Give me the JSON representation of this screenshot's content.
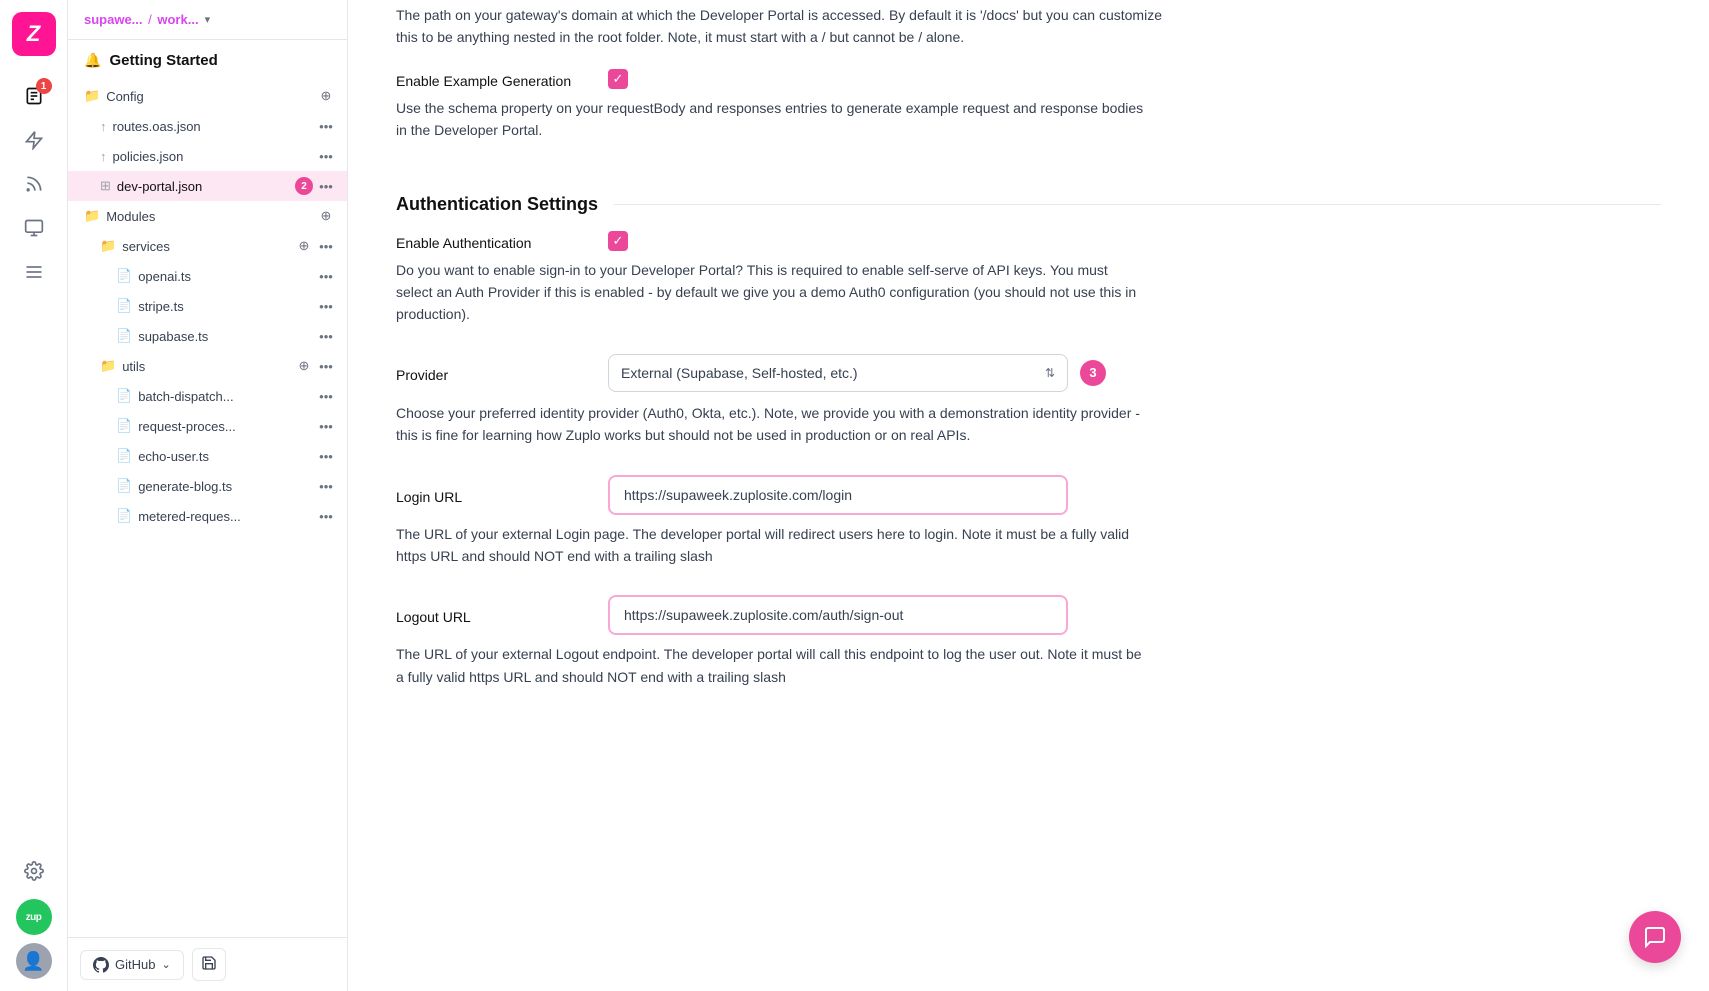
{
  "app": {
    "logo": "Z",
    "workspace": {
      "org": "supawe...",
      "sep": "/",
      "work": "work...",
      "chevron": "▾"
    }
  },
  "sidebar": {
    "getting_started": "Getting Started",
    "items": [
      {
        "id": "config",
        "label": "Config",
        "icon": "folder",
        "indent": 0,
        "has_plus": true
      },
      {
        "id": "routes-oas",
        "label": "routes.oas.json",
        "icon": "file-arrow",
        "indent": 1,
        "has_dots": true
      },
      {
        "id": "policies-json",
        "label": "policies.json",
        "icon": "file-arrow",
        "indent": 1,
        "has_dots": true
      },
      {
        "id": "dev-portal-json",
        "label": "dev-portal.json",
        "icon": "grid",
        "indent": 1,
        "has_dots": true,
        "active": true,
        "badge": "2"
      },
      {
        "id": "modules",
        "label": "Modules",
        "icon": "folder",
        "indent": 0,
        "has_plus": true
      },
      {
        "id": "services",
        "label": "services",
        "icon": "folder",
        "indent": 1,
        "has_plus": true,
        "has_dots": true
      },
      {
        "id": "openai-ts",
        "label": "openai.ts",
        "icon": "file",
        "indent": 2,
        "has_dots": true
      },
      {
        "id": "stripe-ts",
        "label": "stripe.ts",
        "icon": "file",
        "indent": 2,
        "has_dots": true
      },
      {
        "id": "supabase-ts",
        "label": "supabase.ts",
        "icon": "file",
        "indent": 2,
        "has_dots": true
      },
      {
        "id": "utils",
        "label": "utils",
        "icon": "folder",
        "indent": 1,
        "has_plus": true,
        "has_dots": true
      },
      {
        "id": "batch-dispatch",
        "label": "batch-dispatch...",
        "icon": "file",
        "indent": 2,
        "has_dots": true
      },
      {
        "id": "request-process",
        "label": "request-proces...",
        "icon": "file",
        "indent": 2,
        "has_dots": true
      },
      {
        "id": "echo-user-ts",
        "label": "echo-user.ts",
        "icon": "file",
        "indent": 2,
        "has_dots": true
      },
      {
        "id": "generate-blog",
        "label": "generate-blog.ts",
        "icon": "file",
        "indent": 2,
        "has_dots": true
      },
      {
        "id": "metered-reques",
        "label": "metered-reques...",
        "icon": "file",
        "indent": 2,
        "has_dots": true
      }
    ],
    "footer": {
      "github_label": "GitHub",
      "save_icon": "💾"
    }
  },
  "icons": {
    "docs": "📄",
    "lightning": "⚡",
    "feed": "📡",
    "monitor": "🖥",
    "list": "☰",
    "settings": "⚙",
    "zup": "zup",
    "chat": "💬"
  },
  "main": {
    "intro_text": "The path on your gateway's domain at which the Developer Portal is accessed. By default it is '/docs' but you can customize this to be anything nested in the root folder. Note, it must start with a / but cannot be / alone.",
    "enable_example": {
      "label": "Enable Example Generation",
      "checked": true,
      "desc": "Use the schema property on your requestBody and responses entries to generate example request and response bodies in the Developer Portal."
    },
    "auth_settings_heading": "Authentication Settings",
    "enable_auth": {
      "label": "Enable Authentication",
      "checked": true,
      "desc": "Do you want to enable sign-in to your Developer Portal? This is required to enable self-serve of API keys. You must select an Auth Provider if this is enabled - by default we give you a demo Auth0 configuration (you should not use this in production)."
    },
    "provider": {
      "label": "Provider",
      "value": "External (Supabase, Self-hosted, etc.)",
      "step_badge": "3",
      "desc": "Choose your preferred identity provider (Auth0, Okta, etc.). Note, we provide you with a demonstration identity provider - this is fine for learning how Zuplo works but should not be used in production or on real APIs."
    },
    "login_url": {
      "label": "Login URL",
      "value": "https://supaweek.zuplosite.com/login",
      "desc": "The URL of your external Login page. The developer portal will redirect users here to login. Note it must be a fully valid https URL and should NOT end with a trailing slash"
    },
    "logout_url": {
      "label": "Logout URL",
      "value": "https://supaweek.zuplosite.com/auth/sign-out",
      "desc": "The URL of your external Logout endpoint. The developer portal will call this endpoint to log the user out. Note it must be a fully valid https URL and should NOT end with a trailing slash"
    }
  }
}
